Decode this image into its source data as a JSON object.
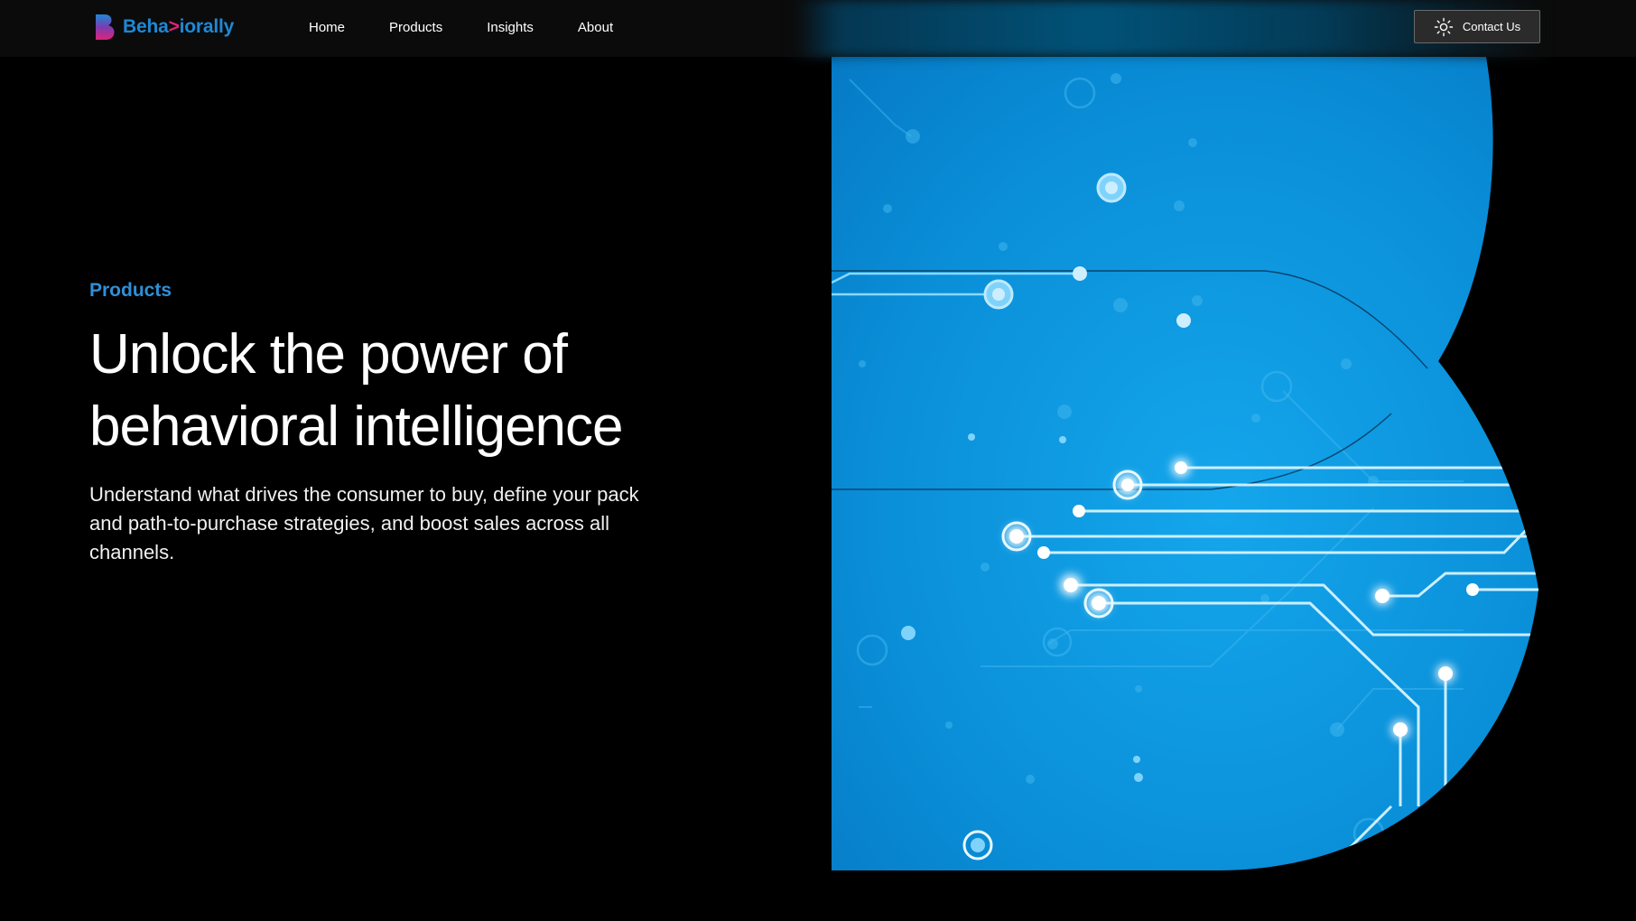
{
  "header": {
    "logo": {
      "prefix": "Beha",
      "glyph": ">",
      "suffix": "iorally"
    },
    "nav": [
      {
        "label": "Home"
      },
      {
        "label": "Products"
      },
      {
        "label": "Insights"
      },
      {
        "label": "About"
      }
    ],
    "contact": {
      "label": "Contact Us",
      "icon": "sun-icon"
    }
  },
  "hero": {
    "eyebrow": "Products",
    "title_line1": "Unlock the power of",
    "title_line2": "behavioral intelligence",
    "description": "Understand what drives the consumer to buy, define your pack and path-to-purchase strategies, and boost sales across all channels.",
    "art": {
      "shape": "letter-B",
      "motif": "circuit-board",
      "icon": "circuit-b-illustration"
    }
  },
  "colors": {
    "background": "#000000",
    "header": "#0b0b0b",
    "accent_blue": "#1e88d6",
    "accent_pink": "#e0237a",
    "art_blue": "#0a8fd8",
    "circuit_glow": "#bfefff"
  }
}
